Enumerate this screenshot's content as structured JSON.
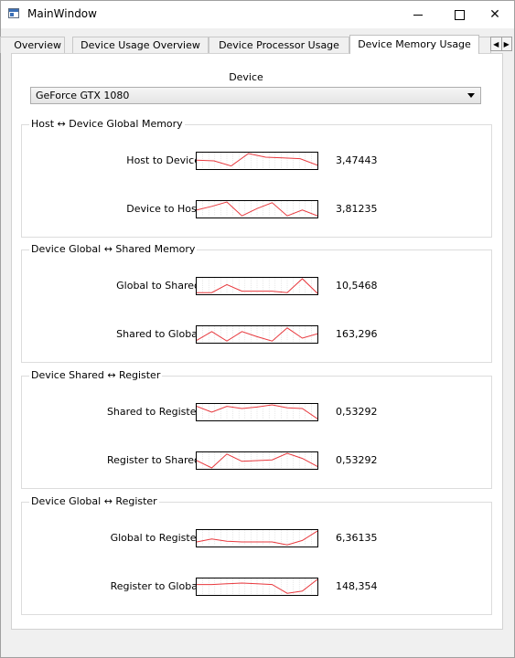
{
  "window": {
    "title": "MainWindow"
  },
  "tabs": [
    "Overview",
    "Device Usage Overview",
    "Device Processor Usage",
    "Device Memory Usage"
  ],
  "active_tab": "Device Memory Usage",
  "device": {
    "label": "Device",
    "selected": "GeForce GTX 1080"
  },
  "groups": [
    {
      "title": "Host ↔ Device Global Memory",
      "rows": [
        {
          "label": "Host to Device",
          "value": "3,47443",
          "spark": [
            0.45,
            0.5,
            0.85,
            0.0,
            0.25,
            0.3,
            0.35,
            0.8
          ]
        },
        {
          "label": "Device to Host",
          "value": "3,81235",
          "spark": [
            0.55,
            0.3,
            0.0,
            0.95,
            0.45,
            0.05,
            0.95,
            0.55,
            0.95
          ]
        }
      ]
    },
    {
      "title": "Device Global ↔ Shared Memory",
      "rows": [
        {
          "label": "Global to Shared",
          "value": "10,5468",
          "spark": [
            0.95,
            0.95,
            0.4,
            0.85,
            0.85,
            0.85,
            0.95,
            0.0,
            1.0
          ]
        },
        {
          "label": "Shared to Global",
          "value": "163,296",
          "spark": [
            0.9,
            0.3,
            0.95,
            0.3,
            0.65,
            0.95,
            0.05,
            0.75,
            0.45
          ]
        }
      ]
    },
    {
      "title": "Device Shared ↔ Register",
      "rows": [
        {
          "label": "Shared to Register",
          "value": "0,53292",
          "spark": [
            0.1,
            0.5,
            0.1,
            0.25,
            0.15,
            0.0,
            0.2,
            0.25,
            0.95
          ]
        },
        {
          "label": "Register to Shared",
          "value": "0,53292",
          "spark": [
            0.5,
            1.0,
            0.05,
            0.55,
            0.5,
            0.45,
            0.0,
            0.35,
            0.9
          ]
        }
      ]
    },
    {
      "title": "Device Global ↔ Register",
      "rows": [
        {
          "label": "Global to Register",
          "value": "6,36135",
          "spark": [
            0.75,
            0.55,
            0.7,
            0.75,
            0.75,
            0.75,
            0.95,
            0.65,
            0.0
          ]
        },
        {
          "label": "Register to Global",
          "value": "148,354",
          "spark": [
            0.35,
            0.35,
            0.3,
            0.25,
            0.3,
            0.35,
            0.95,
            0.8,
            0.0
          ]
        }
      ]
    }
  ],
  "colors": {
    "spark_line": "#e8383d",
    "grid": "#c8c8c8"
  }
}
